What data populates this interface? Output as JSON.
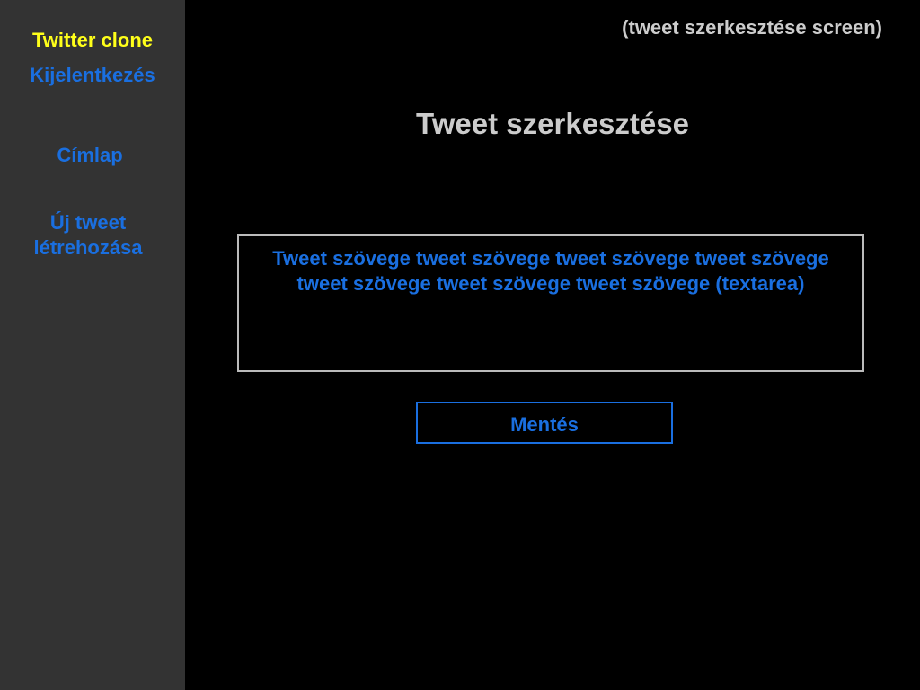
{
  "sidebar": {
    "brand": "Twitter clone",
    "logout": "Kijelentkezés",
    "home": "Címlap",
    "new_tweet_line1": "Új tweet",
    "new_tweet_line2": "létrehozása"
  },
  "header": {
    "screen_label": "(tweet szerkesztése screen)"
  },
  "main": {
    "title": "Tweet szerkesztése",
    "tweet_text": "Tweet szövege tweet szövege tweet szövege tweet szövege tweet szövege tweet szövege tweet szövege (textarea)",
    "save_label": "Mentés"
  },
  "colors": {
    "background": "#000000",
    "sidebar": "#333333",
    "brand": "#ffff1a",
    "link": "#1a6fe0",
    "heading": "#cccccc",
    "textarea_border": "#bbbbbb"
  }
}
